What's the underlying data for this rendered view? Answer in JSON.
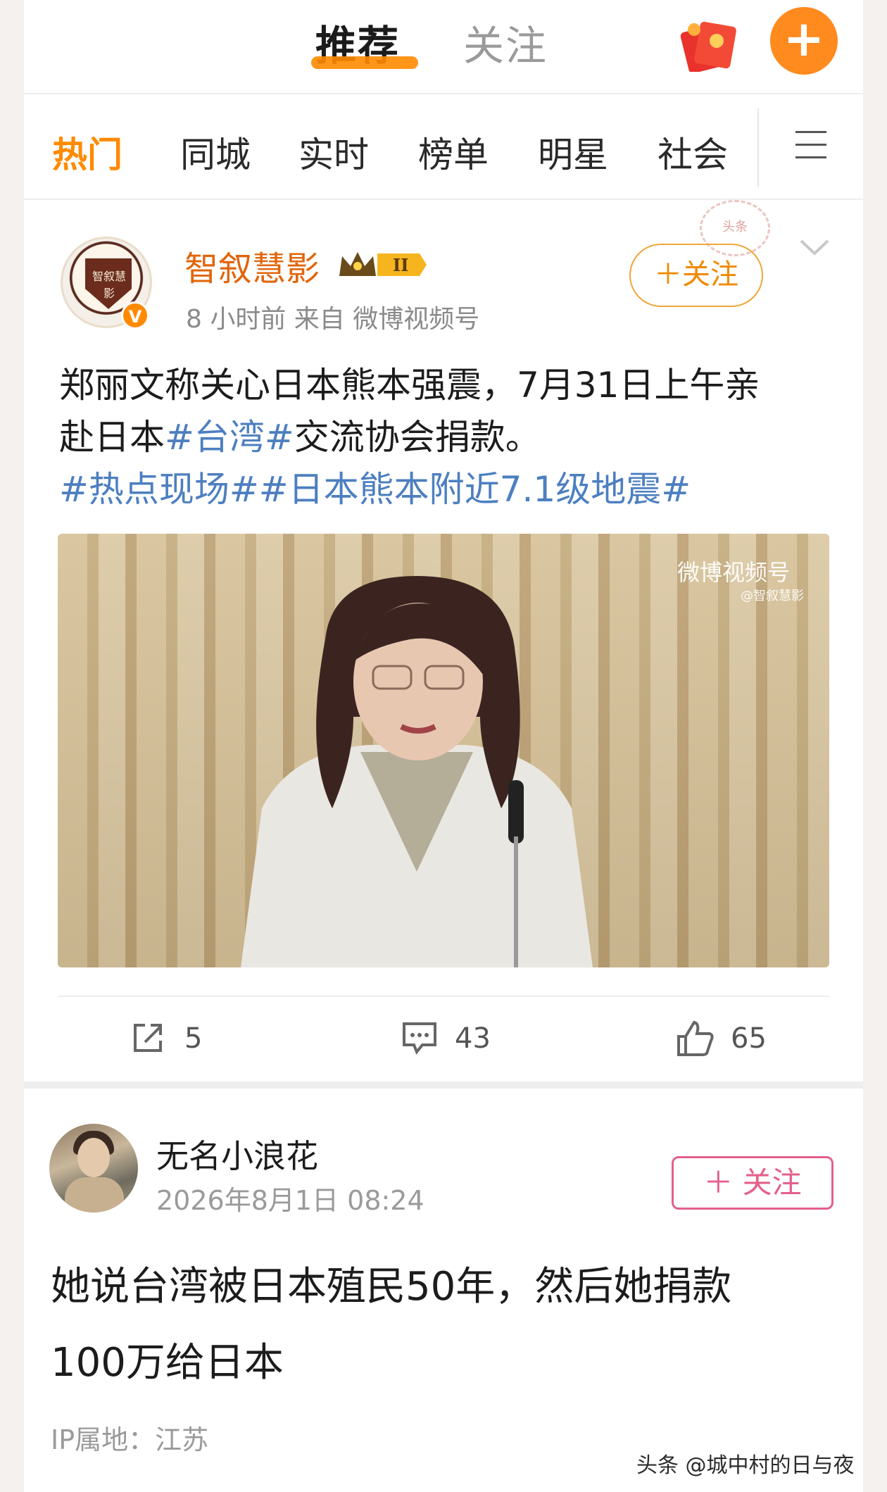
{
  "top_tabs": {
    "active": "推荐",
    "inactive": "关注"
  },
  "plus_label": "+",
  "channels": [
    "热门",
    "同城",
    "实时",
    "榜单",
    "明星",
    "社会"
  ],
  "post1": {
    "author": "智叙慧影",
    "verified_mark": "V",
    "avatar_text": "智叙慧影",
    "stamp_text": "头条",
    "meta": "8 小时前  来自 微博视频号",
    "follow_label": "＋关注",
    "text_line1": "郑丽文称关心日本熊本强震，7月31日上午亲",
    "text_line2_plain1": "赴日本",
    "text_line2_tag": "#台湾#",
    "text_line2_plain2": "交流协会捐款。",
    "tags_line": "#热点现场##日本熊本附近7.1级地震#",
    "video_watermark": "微博视频号",
    "video_watermark_sub": "@智叙慧影",
    "shares": "5",
    "comments": "43",
    "likes": "65"
  },
  "post2": {
    "author": "无名小浪花",
    "time": "2026年8月1日 08:24",
    "follow_label": "＋ 关注",
    "text_line1": "她说台湾被日本殖民50年，然后她捐款",
    "text_line2": "100万给日本",
    "ip_location": "IP属地：江苏"
  },
  "source_mark": "头条 @城中村的日与夜",
  "colors": {
    "accent_orange": "#ff8a00",
    "tag_blue": "#4d7fc0",
    "follow_pink": "#e4608a"
  }
}
